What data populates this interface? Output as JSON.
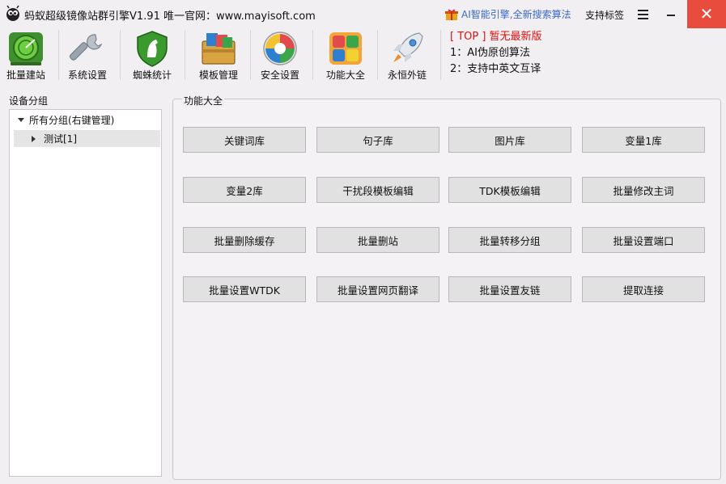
{
  "window": {
    "title": "蚂蚁超级镜像站群引擎V1.91 唯一官网：www.mayisoft.com",
    "ai_promo": "AI智能引擎,全新搜索算法",
    "support_tag": "支持标签",
    "close_glyph": "✕"
  },
  "toolbar": {
    "items": [
      {
        "label": "批量建站",
        "icon": "radar-icon"
      },
      {
        "label": "系统设置",
        "icon": "wrench-icon"
      },
      {
        "label": "蜘蛛统计",
        "icon": "shield-horse-icon"
      },
      {
        "label": "模板管理",
        "icon": "template-box-icon"
      },
      {
        "label": "安全设置",
        "icon": "security-globe-icon"
      },
      {
        "label": "功能大全",
        "icon": "puzzle-blocks-icon"
      },
      {
        "label": "永恒外链",
        "icon": "rocket-icon"
      }
    ]
  },
  "news": {
    "headline": "[ TOP ] 暂无最新版",
    "line1": "1：AI伪原创算法",
    "line2": "2：支持中英文互译"
  },
  "left_panel": {
    "title": "设备分组",
    "tree": {
      "root": "所有分组(右键管理)",
      "child": "测试[1]"
    }
  },
  "right_panel": {
    "title": "功能大全",
    "buttons": [
      "关键词库",
      "句子库",
      "图片库",
      "变量1库",
      "变量2库",
      "干扰段模板编辑",
      "TDK模板编辑",
      "批量修改主词",
      "批量删除缓存",
      "批量删站",
      "批量转移分组",
      "批量设置端口",
      "批量设置WTDK",
      "批量设置网页翻译",
      "批量设置友链",
      "提取连接"
    ]
  },
  "colors": {
    "accent_blue": "#3b69c8",
    "close_red": "#e74c3c",
    "news_red": "#dd1111"
  }
}
